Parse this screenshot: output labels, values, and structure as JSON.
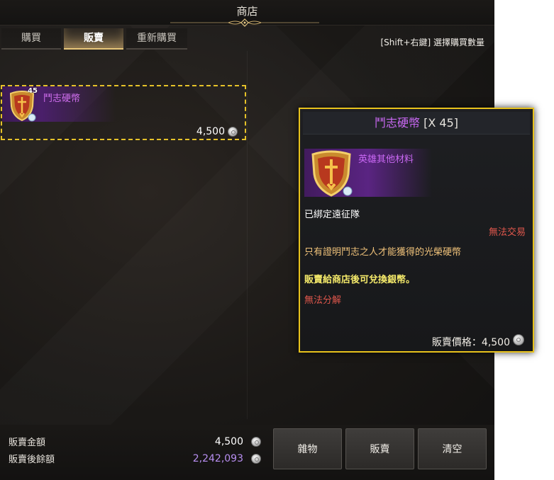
{
  "window": {
    "title": "商店"
  },
  "tabs": [
    {
      "label": "購買",
      "active": false
    },
    {
      "label": "販賣",
      "active": true
    },
    {
      "label": "重新購買",
      "active": false
    }
  ],
  "hint": "[Shift+右鍵] 選擇購買數量",
  "sell_list": {
    "items": [
      {
        "name": "鬥志硬幣",
        "count": "45",
        "price": "4,500",
        "icon": "shield-coin-icon"
      }
    ]
  },
  "tooltip": {
    "name": "鬥志硬幣",
    "quantity": "[X 45]",
    "category": "英雄其他材料",
    "bound": "已綁定遠征隊",
    "trade": "無法交易",
    "description": "只有證明鬥志之人才能獲得的光榮硬幣",
    "sell_note": "販賣給商店後可兌換銀幣。",
    "dismantle": "無法分解",
    "price_label": "販賣價格：4,500"
  },
  "summary": {
    "sell_total_label": "販賣金額",
    "sell_total_value": "4,500",
    "balance_label": "販賣後餘額",
    "balance_value": "2,242,093"
  },
  "buttons": {
    "misc": "雜物",
    "sell": "販賣",
    "clear": "清空"
  },
  "colors": {
    "accent_gold": "#e8c21c",
    "epic_purple": "#c968f3",
    "warning_red": "#e0574c",
    "balance_purple": "#b78ef0"
  }
}
